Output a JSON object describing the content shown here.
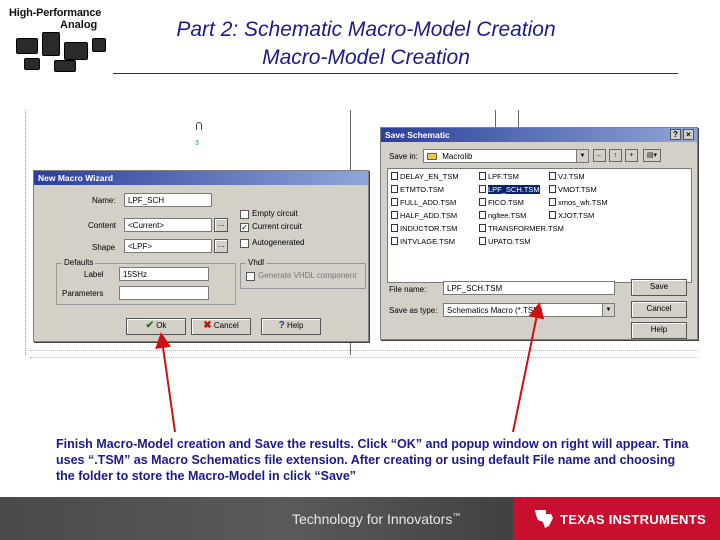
{
  "header": {
    "logo_line1": "High-Performance",
    "logo_line2": "Analog",
    "title_line1": "Part 2: Schematic Macro-Model Creation",
    "title_line2": "Macro-Model Creation"
  },
  "macro_wizard": {
    "title": "New Macro Wizard",
    "name_label": "Name:",
    "name_value": "LPF_SCH",
    "content_label": "Content",
    "content_value": "<Current>",
    "shape_label": "Shape",
    "shape_value": "<LPF>",
    "defaults_label": "Defaults",
    "label_label": "Label",
    "label_value": "15SHz",
    "parameters_label": "Parameters",
    "empty_circuit": "Empty circuit",
    "current_circuit": "Current circuit",
    "autogenerated": "Autogenerated",
    "vhdl_label": "Vhdl",
    "generate_vhdl": "Generate VHDL component",
    "ok": "Ok",
    "cancel": "Cancel",
    "help": "Help"
  },
  "save_dialog": {
    "title": "Save Schematic",
    "save_in_label": "Save in:",
    "save_in_value": "Macrolib",
    "files": [
      "DELAY_EN_TSM",
      "LPF.TSM",
      "VJ.TSM",
      "ETMTO.TSM",
      "LPF_SCH.TSM",
      "VMOT.TSM",
      "FULL_ADD.TSM",
      "FICO.TSM",
      "xmos_wh.TSM",
      "HALF_ADD.TSM",
      "ngltee.TSM",
      "XJOT.TSM",
      "INDUCTOR.TSM",
      "TRANSFORMER.TSM",
      "INTVLAGE.TSM",
      "UPATO.TSM"
    ],
    "file_name_label": "File name:",
    "file_name_value": "LPF_SCH.TSM",
    "save_as_label": "Save as type:",
    "save_as_value": "Schematics Macro (*.TSM)",
    "save": "Save",
    "cancel": "Cancel",
    "help": "Help"
  },
  "caption": "Finish Macro-Model creation and Save the results. Click “OK” and popup window on right will appear. Tina uses “.TSM” as Macro Schematics file extension. After creating or using default File name and choosing the folder to store the Macro-Model in click “Save”",
  "footer": {
    "tagline": "Technology for Innovators",
    "tm": "™",
    "company": "TEXAS INSTRUMENTS"
  },
  "colors": {
    "title_blue": "#1a1a8c",
    "ti_red": "#c8102e",
    "arrow_red": "#cc1111"
  }
}
